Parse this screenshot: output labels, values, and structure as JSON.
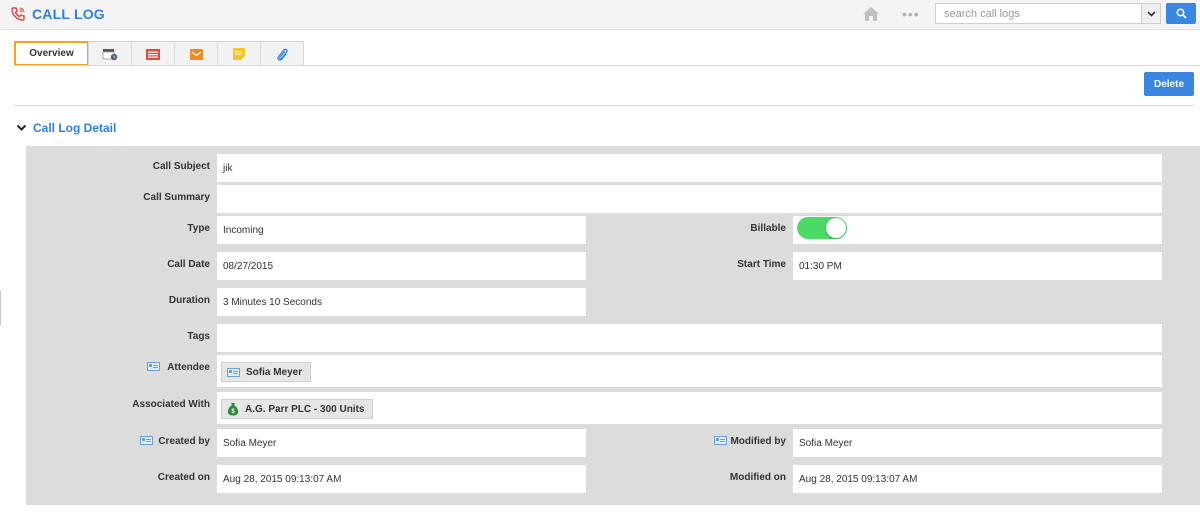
{
  "header": {
    "title": "CALL LOG",
    "search_placeholder": "search call logs"
  },
  "tabs": [
    {
      "label": "Overview",
      "active": true
    },
    {
      "icon": "calendar-clock-icon"
    },
    {
      "icon": "log-list-icon"
    },
    {
      "icon": "email-icon"
    },
    {
      "icon": "note-icon"
    },
    {
      "icon": "attachment-icon"
    }
  ],
  "actions": {
    "delete_label": "Delete"
  },
  "section": {
    "title": "Call Log Detail"
  },
  "fields": {
    "call_subject": {
      "label": "Call Subject",
      "value": "jik"
    },
    "call_summary": {
      "label": "Call Summary",
      "value": ""
    },
    "type": {
      "label": "Type",
      "value": "Incoming"
    },
    "billable": {
      "label": "Billable",
      "on": true
    },
    "call_date": {
      "label": "Call Date",
      "value": "08/27/2015"
    },
    "start_time": {
      "label": "Start Time",
      "value": "01:30 PM"
    },
    "duration": {
      "label": "Duration",
      "value": "3 Minutes 10 Seconds"
    },
    "tags": {
      "label": "Tags",
      "value": ""
    },
    "attendee": {
      "label": "Attendee",
      "value": "Sofia Meyer"
    },
    "associated_with": {
      "label": "Associated With",
      "value": "A.G. Parr PLC - 300 Units"
    },
    "created_by": {
      "label": "Created by",
      "value": "Sofia Meyer"
    },
    "modified_by": {
      "label": "Modified by",
      "value": "Sofia Meyer"
    },
    "created_on": {
      "label": "Created on",
      "value": "Aug 28, 2015 09:13:07 AM"
    },
    "modified_on": {
      "label": "Modified on",
      "value": "Aug 28, 2015 09:13:07 AM"
    }
  },
  "colors": {
    "accent": "#2f7fd8",
    "active_tab_border": "#f6a123",
    "toggle_on": "#4cd964",
    "button": "#3b86e0"
  }
}
